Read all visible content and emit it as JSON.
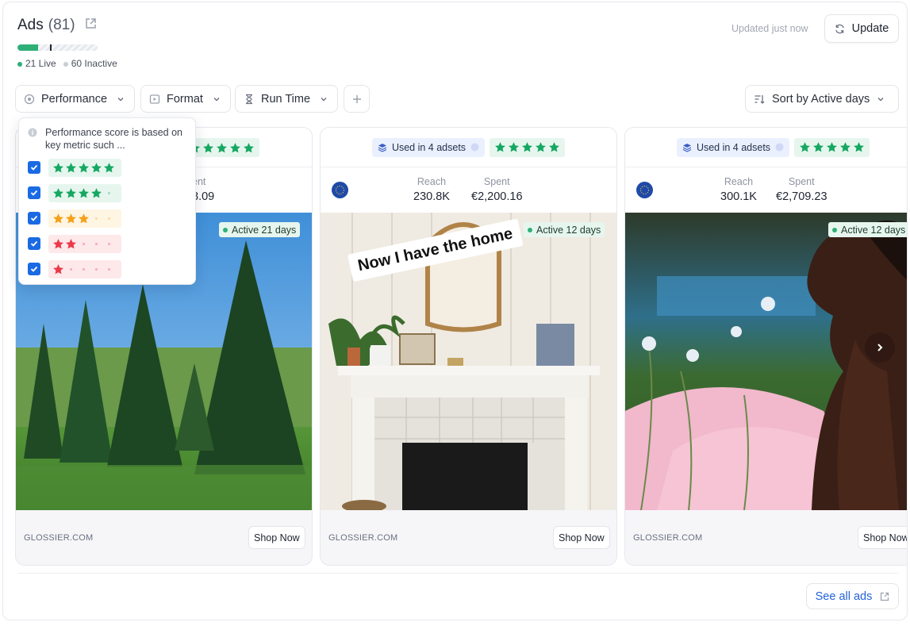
{
  "header": {
    "title": "Ads",
    "count": "(81)",
    "live_label": "21 Live",
    "inactive_label": "60 Inactive",
    "live_fraction": 0.26,
    "updated_text": "Updated just now",
    "update_label": "Update"
  },
  "colors": {
    "live": "#2eaf78",
    "inactive": "#c9cdd5",
    "accent": "#1a6ae3",
    "star_green": "#16a862",
    "star_orange": "#f4a21a",
    "star_red": "#ea3a4a"
  },
  "filters": [
    {
      "label": "Performance",
      "icon": "performance-icon"
    },
    {
      "label": "Format",
      "icon": "play-icon"
    },
    {
      "label": "Run Time",
      "icon": "hourglass-icon"
    }
  ],
  "add_filter_icon": "plus-icon",
  "sort": {
    "label": "Sort by Active days",
    "icon": "sort-icon"
  },
  "performance_dropdown": {
    "note": "Performance score is based on key metric such ...",
    "options": [
      {
        "stars": 5,
        "checked": true,
        "tone": "green"
      },
      {
        "stars": 4,
        "checked": true,
        "tone": "green"
      },
      {
        "stars": 3,
        "checked": true,
        "tone": "orange"
      },
      {
        "stars": 2,
        "checked": true,
        "tone": "red"
      },
      {
        "stars": 1,
        "checked": true,
        "tone": "red"
      }
    ]
  },
  "cards": [
    {
      "adsets": "",
      "rating": 5,
      "reach_label": "",
      "reach": "",
      "spent_label": "ent",
      "spent": "8.09",
      "active": "Active 21 days",
      "domain": "GLOSSIER.COM",
      "cta": "Shop Now",
      "image": "pine-trees-photo"
    },
    {
      "adsets": "Used in 4 adsets",
      "rating": 5,
      "reach_label": "Reach",
      "reach": "230.8K",
      "spent_label": "Spent",
      "spent": "€2,200.16",
      "active": "Active 12 days",
      "domain": "GLOSSIER.COM",
      "cta": "Shop Now",
      "image": "fireplace-photo",
      "overlay_text": "Now I have the home"
    },
    {
      "adsets": "Used in 4 adsets",
      "rating": 5,
      "reach_label": "Reach",
      "reach": "300.1K",
      "spent_label": "Spent",
      "spent": "€2,709.23",
      "active": "Active 12 days",
      "domain": "GLOSSIER.COM",
      "cta": "Shop Now",
      "image": "woman-portrait-photo"
    }
  ],
  "footer": {
    "see_all_label": "See all ads",
    "icon": "external-link-icon"
  }
}
